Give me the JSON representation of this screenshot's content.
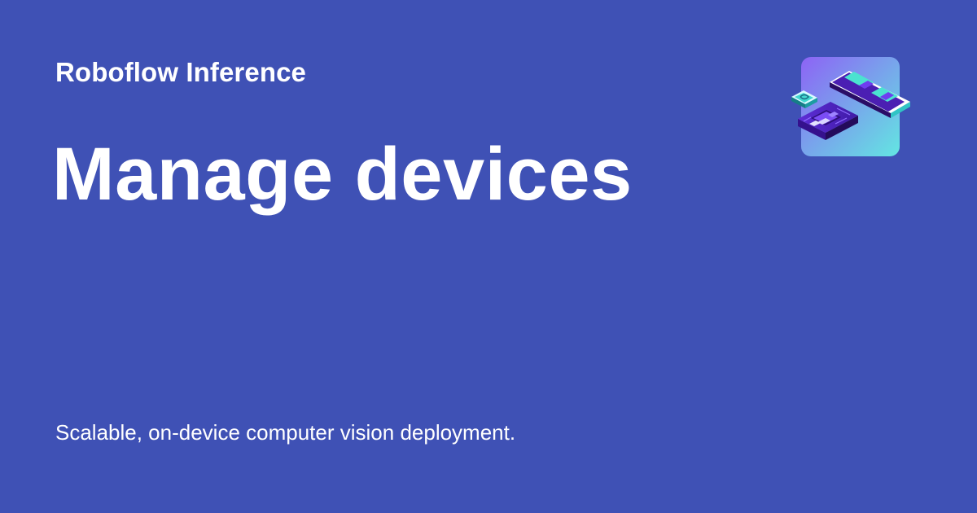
{
  "header": {
    "product_name": "Roboflow Inference"
  },
  "main": {
    "title": "Manage devices",
    "subtitle": "Scalable, on-device computer vision deployment."
  },
  "logo": {
    "icon": "device-hardware-icon"
  },
  "colors": {
    "background": "#3f51b5",
    "text": "#ffffff",
    "logo_gradient_start": "#8d63f5",
    "logo_gradient_end": "#63e6e2",
    "device_purple": "#4b1fb3",
    "device_dark": "#2a0d66",
    "device_teal": "#32d3c1"
  }
}
